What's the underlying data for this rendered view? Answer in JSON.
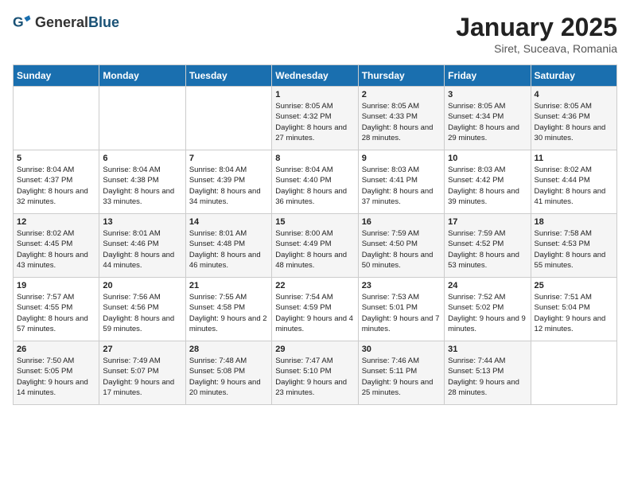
{
  "header": {
    "logo_general": "General",
    "logo_blue": "Blue",
    "title": "January 2025",
    "subtitle": "Siret, Suceava, Romania"
  },
  "days_of_week": [
    "Sunday",
    "Monday",
    "Tuesday",
    "Wednesday",
    "Thursday",
    "Friday",
    "Saturday"
  ],
  "weeks": [
    [
      {
        "day": "",
        "info": ""
      },
      {
        "day": "",
        "info": ""
      },
      {
        "day": "",
        "info": ""
      },
      {
        "day": "1",
        "info": "Sunrise: 8:05 AM\nSunset: 4:32 PM\nDaylight: 8 hours and 27 minutes."
      },
      {
        "day": "2",
        "info": "Sunrise: 8:05 AM\nSunset: 4:33 PM\nDaylight: 8 hours and 28 minutes."
      },
      {
        "day": "3",
        "info": "Sunrise: 8:05 AM\nSunset: 4:34 PM\nDaylight: 8 hours and 29 minutes."
      },
      {
        "day": "4",
        "info": "Sunrise: 8:05 AM\nSunset: 4:36 PM\nDaylight: 8 hours and 30 minutes."
      }
    ],
    [
      {
        "day": "5",
        "info": "Sunrise: 8:04 AM\nSunset: 4:37 PM\nDaylight: 8 hours and 32 minutes."
      },
      {
        "day": "6",
        "info": "Sunrise: 8:04 AM\nSunset: 4:38 PM\nDaylight: 8 hours and 33 minutes."
      },
      {
        "day": "7",
        "info": "Sunrise: 8:04 AM\nSunset: 4:39 PM\nDaylight: 8 hours and 34 minutes."
      },
      {
        "day": "8",
        "info": "Sunrise: 8:04 AM\nSunset: 4:40 PM\nDaylight: 8 hours and 36 minutes."
      },
      {
        "day": "9",
        "info": "Sunrise: 8:03 AM\nSunset: 4:41 PM\nDaylight: 8 hours and 37 minutes."
      },
      {
        "day": "10",
        "info": "Sunrise: 8:03 AM\nSunset: 4:42 PM\nDaylight: 8 hours and 39 minutes."
      },
      {
        "day": "11",
        "info": "Sunrise: 8:02 AM\nSunset: 4:44 PM\nDaylight: 8 hours and 41 minutes."
      }
    ],
    [
      {
        "day": "12",
        "info": "Sunrise: 8:02 AM\nSunset: 4:45 PM\nDaylight: 8 hours and 43 minutes."
      },
      {
        "day": "13",
        "info": "Sunrise: 8:01 AM\nSunset: 4:46 PM\nDaylight: 8 hours and 44 minutes."
      },
      {
        "day": "14",
        "info": "Sunrise: 8:01 AM\nSunset: 4:48 PM\nDaylight: 8 hours and 46 minutes."
      },
      {
        "day": "15",
        "info": "Sunrise: 8:00 AM\nSunset: 4:49 PM\nDaylight: 8 hours and 48 minutes."
      },
      {
        "day": "16",
        "info": "Sunrise: 7:59 AM\nSunset: 4:50 PM\nDaylight: 8 hours and 50 minutes."
      },
      {
        "day": "17",
        "info": "Sunrise: 7:59 AM\nSunset: 4:52 PM\nDaylight: 8 hours and 53 minutes."
      },
      {
        "day": "18",
        "info": "Sunrise: 7:58 AM\nSunset: 4:53 PM\nDaylight: 8 hours and 55 minutes."
      }
    ],
    [
      {
        "day": "19",
        "info": "Sunrise: 7:57 AM\nSunset: 4:55 PM\nDaylight: 8 hours and 57 minutes."
      },
      {
        "day": "20",
        "info": "Sunrise: 7:56 AM\nSunset: 4:56 PM\nDaylight: 8 hours and 59 minutes."
      },
      {
        "day": "21",
        "info": "Sunrise: 7:55 AM\nSunset: 4:58 PM\nDaylight: 9 hours and 2 minutes."
      },
      {
        "day": "22",
        "info": "Sunrise: 7:54 AM\nSunset: 4:59 PM\nDaylight: 9 hours and 4 minutes."
      },
      {
        "day": "23",
        "info": "Sunrise: 7:53 AM\nSunset: 5:01 PM\nDaylight: 9 hours and 7 minutes."
      },
      {
        "day": "24",
        "info": "Sunrise: 7:52 AM\nSunset: 5:02 PM\nDaylight: 9 hours and 9 minutes."
      },
      {
        "day": "25",
        "info": "Sunrise: 7:51 AM\nSunset: 5:04 PM\nDaylight: 9 hours and 12 minutes."
      }
    ],
    [
      {
        "day": "26",
        "info": "Sunrise: 7:50 AM\nSunset: 5:05 PM\nDaylight: 9 hours and 14 minutes."
      },
      {
        "day": "27",
        "info": "Sunrise: 7:49 AM\nSunset: 5:07 PM\nDaylight: 9 hours and 17 minutes."
      },
      {
        "day": "28",
        "info": "Sunrise: 7:48 AM\nSunset: 5:08 PM\nDaylight: 9 hours and 20 minutes."
      },
      {
        "day": "29",
        "info": "Sunrise: 7:47 AM\nSunset: 5:10 PM\nDaylight: 9 hours and 23 minutes."
      },
      {
        "day": "30",
        "info": "Sunrise: 7:46 AM\nSunset: 5:11 PM\nDaylight: 9 hours and 25 minutes."
      },
      {
        "day": "31",
        "info": "Sunrise: 7:44 AM\nSunset: 5:13 PM\nDaylight: 9 hours and 28 minutes."
      },
      {
        "day": "",
        "info": ""
      }
    ]
  ]
}
